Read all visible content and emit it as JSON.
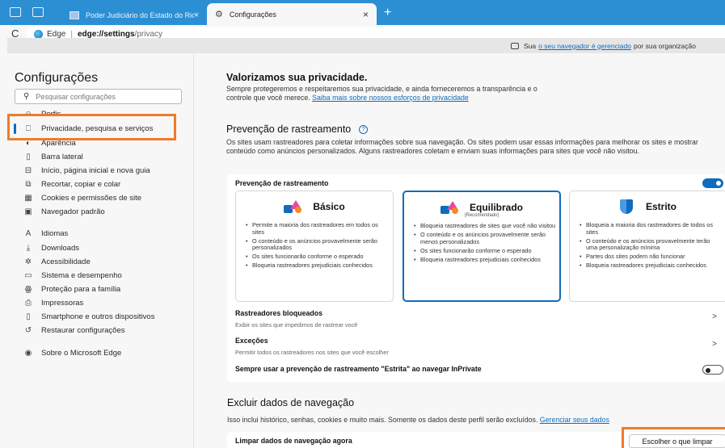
{
  "tabs": {
    "tab1_title": "Poder Judiciário do Estado do Rio",
    "tab2_title": "Configurações",
    "close_glyph": "×",
    "new_tab_glyph": "+"
  },
  "address": {
    "refresh_glyph": "C",
    "site_label": "Edge",
    "url_bold": "edge://settings",
    "url_rest": "/privacy"
  },
  "managed": {
    "prefix": "Sua",
    "link": "o seu navegador é gerenciado",
    "suffix": "por sua organização"
  },
  "sidebar": {
    "title": "Configurações",
    "search_placeholder": "Pesquisar configurações",
    "items": [
      {
        "label": "Perfis",
        "icon": "profile-icon",
        "glyph": "☺"
      },
      {
        "label": "Privacidade, pesquisa e serviços",
        "icon": "lock-icon",
        "glyph": "🔒"
      },
      {
        "label": "Aparência",
        "icon": "appearance-icon",
        "glyph": "◐"
      },
      {
        "label": "Barra lateral",
        "icon": "sidebar-icon",
        "glyph": "▯"
      },
      {
        "label": "Início, página inicial e nova guia",
        "icon": "home-icon",
        "glyph": "⊟"
      },
      {
        "label": "Recortar, copiar e colar",
        "icon": "share-icon",
        "glyph": "⧉"
      },
      {
        "label": "Cookies e permissões de site",
        "icon": "cookies-icon",
        "glyph": "▦"
      },
      {
        "label": "Navegador padrão",
        "icon": "browser-icon",
        "glyph": "▣"
      },
      {
        "label": "Idiomas",
        "icon": "languages-icon",
        "glyph": "A"
      },
      {
        "label": "Downloads",
        "icon": "download-icon",
        "glyph": "⤓"
      },
      {
        "label": "Acessibilidade",
        "icon": "accessibility-icon",
        "glyph": "✲"
      },
      {
        "label": "Sistema e desempenho",
        "icon": "system-icon",
        "glyph": "▭"
      },
      {
        "label": "Proteção para a família",
        "icon": "family-icon",
        "glyph": "ꙮ"
      },
      {
        "label": "Impressoras",
        "icon": "printer-icon",
        "glyph": "⎙"
      },
      {
        "label": "Smartphone e outros dispositivos",
        "icon": "phone-icon",
        "glyph": "▯"
      },
      {
        "label": "Restaurar configurações",
        "icon": "reset-icon",
        "glyph": "↺"
      },
      {
        "label": "Sobre o Microsoft Edge",
        "icon": "edge-icon",
        "glyph": "◉"
      }
    ]
  },
  "privacy": {
    "heading": "Valorizamos sua privacidade.",
    "text": "Sempre protegeremos e respeitaremos sua privacidade, e ainda forneceremos a transparência e o controle que você merece.",
    "link": "Saiba mais sobre nossos esforços de privacidade"
  },
  "tracking": {
    "heading": "Prevenção de rastreamento",
    "help_glyph": "?",
    "description": "Os sites usam rastreadores para coletar informações sobre sua navegação. Os sites podem usar essas informações para melhorar os sites e mostrar conteúdo como anúncios personalizados. Alguns rastreadores coletam e enviam suas informações para sites que você não visitou.",
    "card_title": "Prevenção de rastreamento",
    "toggle_on": true,
    "options": [
      {
        "name": "Básico",
        "subtitle": "",
        "selected": false,
        "bullets": [
          "Permite a maioria dos rastreadores em todos os sites",
          "O conteúdo e os anúncios provavelmente serão personalizados",
          "Os sites funcionarão conforme o esperado",
          "Bloqueia rastreadores prejudiciais conhecidos"
        ]
      },
      {
        "name": "Equilibrado",
        "subtitle": "(Recomendado)",
        "selected": true,
        "bullets": [
          "Bloqueia rastreadores de sites que você não visitou",
          "O conteúdo e os anúncios provavelmente serão menos personalizados",
          "Os sites funcionarão conforme o esperado",
          "Bloqueia rastreadores prejudiciais conhecidos"
        ]
      },
      {
        "name": "Estrito",
        "subtitle": "",
        "selected": false,
        "bullets": [
          "Bloqueia a maioria dos rastreadores de todos os sites",
          "O conteúdo e os anúncios provavelmente terão uma personalização mínima",
          "Partes dos sites podem não funcionar",
          "Bloqueia rastreadores prejudiciais conhecidos"
        ]
      }
    ],
    "blocked_title": "Rastreadores bloqueados",
    "blocked_sub": "Exibir os sites que impedimos de rastrear você",
    "exceptions_title": "Exceções",
    "exceptions_sub": "Permitir todos os rastreadores nos sites que você escolher",
    "inprivate_label": "Sempre usar a prevenção de rastreamento \"Estrita\" ao navegar InPrivate",
    "inprivate_on": false,
    "chevron_glyph": ">"
  },
  "clear": {
    "heading": "Excluir dados de navegação",
    "text": "Isso inclui histórico, senhas, cookies e muito mais. Somente os dados deste perfil serão excluídos.",
    "link": "Gerenciar seus dados",
    "row_title": "Limpar dados de navegação agora",
    "button": "Escolher o que limpar"
  },
  "colors": {
    "accent": "#0f6cbd",
    "tabstrip": "#2c8fd4",
    "highlight": "#ee7b2c"
  }
}
